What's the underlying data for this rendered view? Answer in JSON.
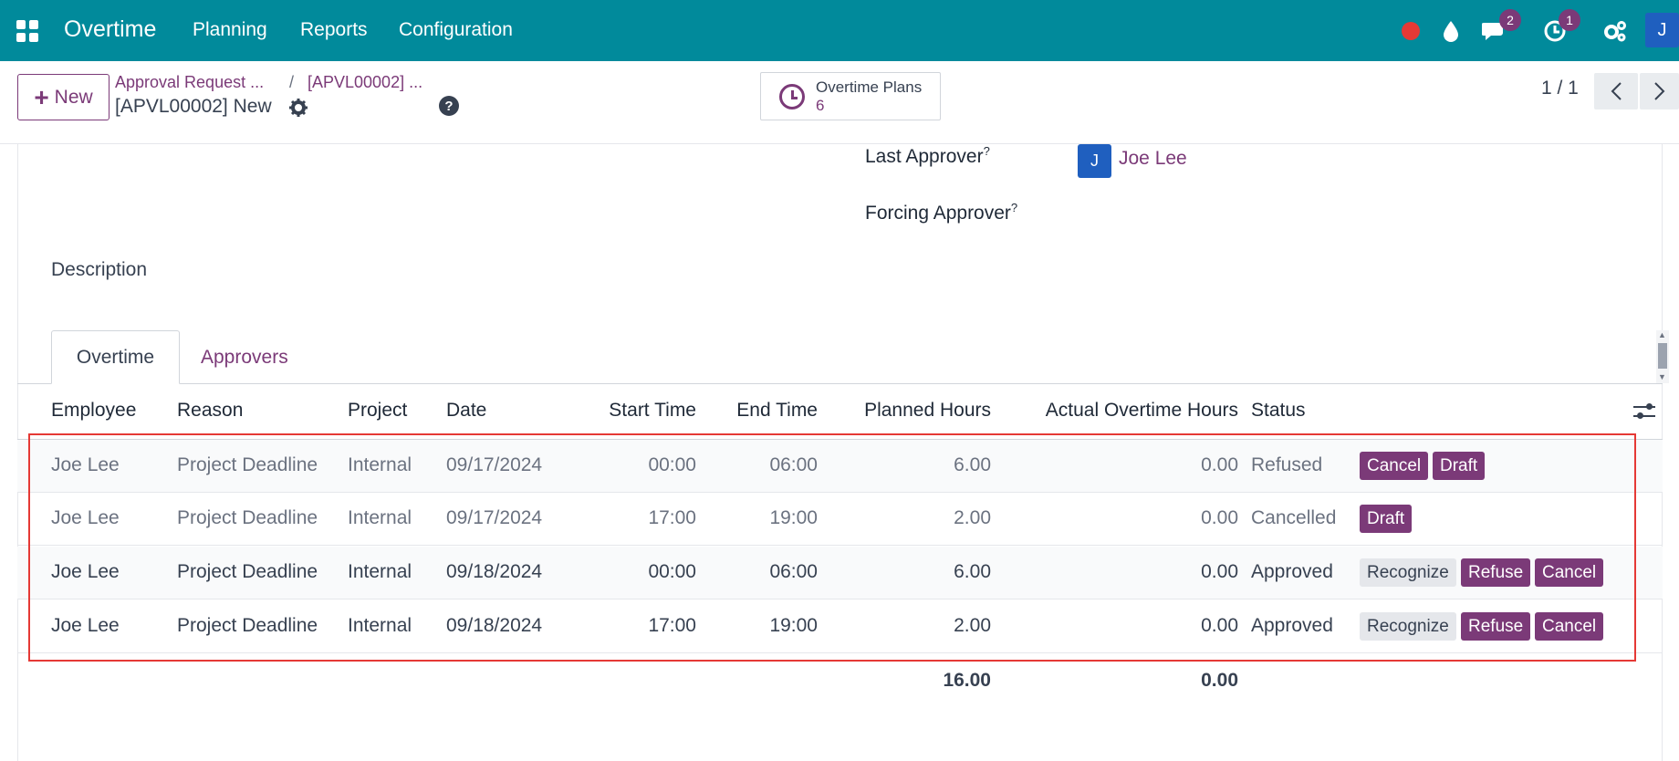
{
  "topbar": {
    "app_name": "Overtime",
    "menu": [
      "Planning",
      "Reports",
      "Configuration"
    ],
    "chat_badge": "2",
    "activity_badge": "1",
    "user_initial": "J"
  },
  "control": {
    "new_label": "New",
    "breadcrumb_parent": "Approval Request ...",
    "breadcrumb_sep": "/",
    "breadcrumb_current": "[APVL00002] ...",
    "record_title": "[APVL00002] New",
    "help_glyph": "?",
    "smart_button": {
      "label": "Overtime Plans",
      "count": "6"
    },
    "pager": "1 / 1"
  },
  "form": {
    "last_approver_label": "Last Approver",
    "forcing_approver_label": "Forcing Approver",
    "help_mark": "?",
    "approver_initial": "J",
    "approver_name": "Joe Lee",
    "description_label": "Description"
  },
  "tabs": [
    "Overtime",
    "Approvers"
  ],
  "table": {
    "headers": [
      "Employee",
      "Reason",
      "Project",
      "Date",
      "Start Time",
      "End Time",
      "Planned Hours",
      "Actual Overtime Hours",
      "Status"
    ],
    "rows": [
      {
        "employee": "Joe Lee",
        "reason": "Project Deadline",
        "project": "Internal",
        "date": "09/17/2024",
        "start": "00:00",
        "end": "06:00",
        "planned": "6.00",
        "actual": "0.00",
        "status": "Refused",
        "actions": [
          "Cancel",
          "Draft"
        ]
      },
      {
        "employee": "Joe Lee",
        "reason": "Project Deadline",
        "project": "Internal",
        "date": "09/17/2024",
        "start": "17:00",
        "end": "19:00",
        "planned": "2.00",
        "actual": "0.00",
        "status": "Cancelled",
        "actions": [
          "Draft"
        ]
      },
      {
        "employee": "Joe Lee",
        "reason": "Project Deadline",
        "project": "Internal",
        "date": "09/18/2024",
        "start": "00:00",
        "end": "06:00",
        "planned": "6.00",
        "actual": "0.00",
        "status": "Approved",
        "actions": [
          "Recognize",
          "Refuse",
          "Cancel"
        ]
      },
      {
        "employee": "Joe Lee",
        "reason": "Project Deadline",
        "project": "Internal",
        "date": "09/18/2024",
        "start": "17:00",
        "end": "19:00",
        "planned": "2.00",
        "actual": "0.00",
        "status": "Approved",
        "actions": [
          "Recognize",
          "Refuse",
          "Cancel"
        ]
      }
    ],
    "totals": {
      "planned": "16.00",
      "actual": "0.00"
    }
  },
  "colors": {
    "navbar": "#018a9b",
    "accent": "#7b3a78",
    "highlight": "#e53935"
  }
}
